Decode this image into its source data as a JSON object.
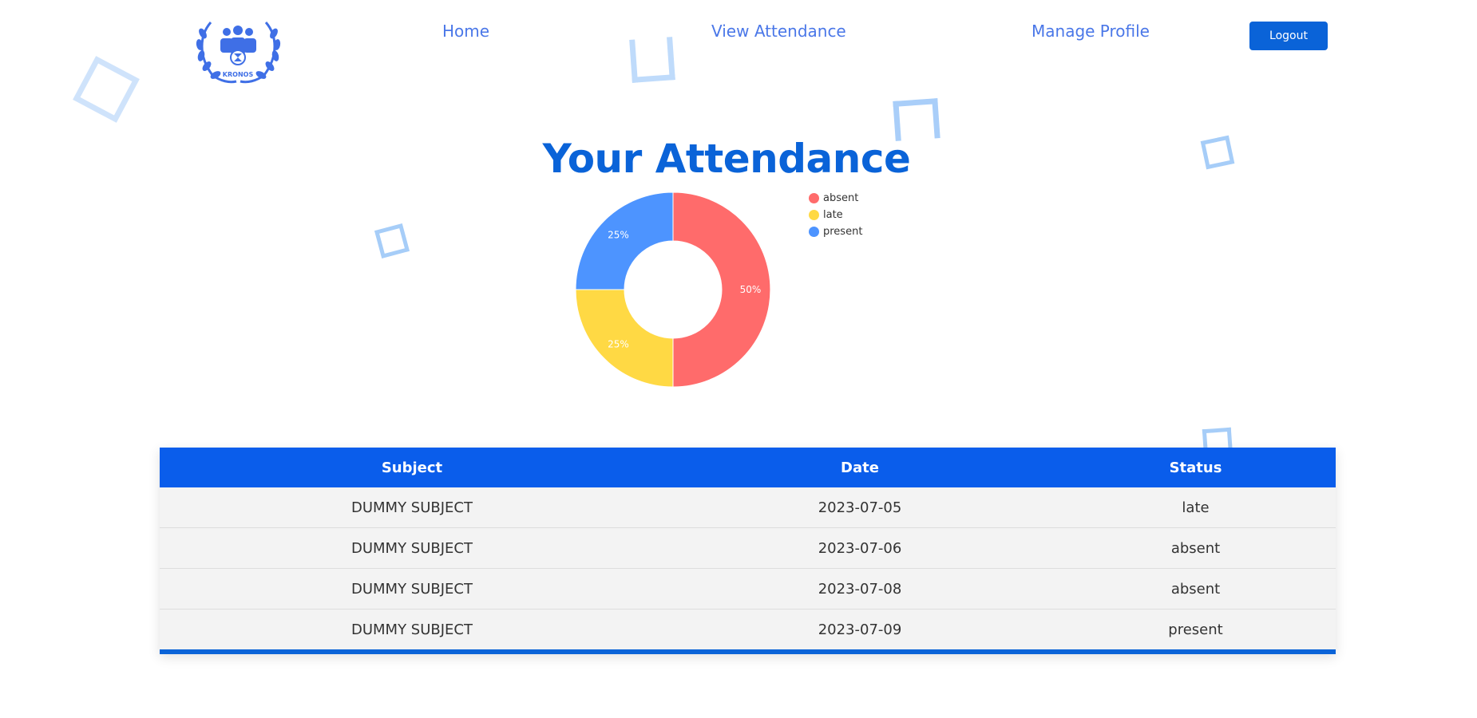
{
  "brand": {
    "logo_text": "KRONOS"
  },
  "nav": {
    "home": "Home",
    "view_attendance": "View Attendance",
    "manage_profile": "Manage Profile",
    "logout": "Logout"
  },
  "page": {
    "title": "Your Attendance"
  },
  "chart_data": {
    "type": "pie",
    "categories": [
      "absent",
      "late",
      "present"
    ],
    "values": [
      50,
      25,
      25
    ],
    "labels": [
      "50%",
      "25%",
      "25%"
    ],
    "colors": [
      "#ff6b6b",
      "#ffd944",
      "#4d94ff"
    ],
    "legend_position": "top-right"
  },
  "table": {
    "headers": [
      "Subject",
      "Date",
      "Status"
    ],
    "rows": [
      [
        "DUMMY SUBJECT",
        "2023-07-05",
        "late"
      ],
      [
        "DUMMY SUBJECT",
        "2023-07-06",
        "absent"
      ],
      [
        "DUMMY SUBJECT",
        "2023-07-08",
        "absent"
      ],
      [
        "DUMMY SUBJECT",
        "2023-07-09",
        "present"
      ]
    ]
  }
}
